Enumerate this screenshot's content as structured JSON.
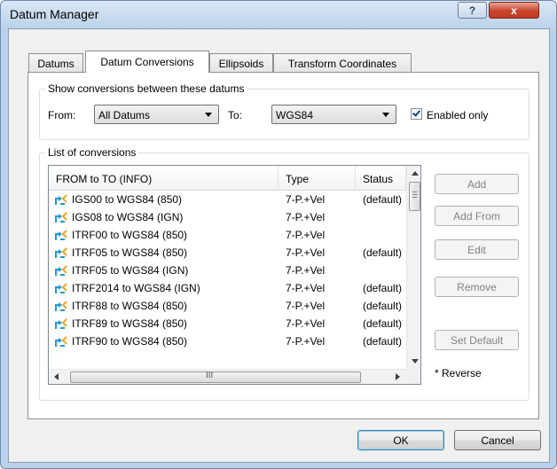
{
  "window": {
    "title": "Datum Manager",
    "help_label": "?",
    "close_label": "x"
  },
  "tabs": [
    {
      "label": "Datums"
    },
    {
      "label": "Datum Conversions"
    },
    {
      "label": "Ellipsoids"
    },
    {
      "label": "Transform Coordinates"
    }
  ],
  "filter": {
    "group_label": "Show conversions between these datums",
    "from_label": "From:",
    "from_value": "All Datums",
    "to_label": "To:",
    "to_value": "WGS84",
    "enabled_only_label": "Enabled only",
    "enabled_only_checked": true
  },
  "list": {
    "group_label": "List of conversions",
    "columns": [
      "FROM to TO (INFO)",
      "Type",
      "Status"
    ],
    "rows": [
      {
        "name": "IGS00 to WGS84 (850)",
        "type": "7-P.+Vel",
        "status": "(default)"
      },
      {
        "name": "IGS08 to WGS84 (IGN)",
        "type": "7-P.+Vel",
        "status": ""
      },
      {
        "name": "ITRF00 to WGS84 (850)",
        "type": "7-P.+Vel",
        "status": ""
      },
      {
        "name": "ITRF05 to WGS84 (850)",
        "type": "7-P.+Vel",
        "status": "(default)"
      },
      {
        "name": "ITRF05 to WGS84 (IGN)",
        "type": "7-P.+Vel",
        "status": ""
      },
      {
        "name": "ITRF2014 to WGS84 (IGN)",
        "type": "7-P.+Vel",
        "status": "(default)"
      },
      {
        "name": "ITRF88 to WGS84 (850)",
        "type": "7-P.+Vel",
        "status": "(default)"
      },
      {
        "name": "ITRF89 to WGS84 (850)",
        "type": "7-P.+Vel",
        "status": "(default)"
      },
      {
        "name": "ITRF90 to WGS84 (850)",
        "type": "7-P.+Vel",
        "status": "(default)"
      }
    ],
    "hscroll_grip": "III"
  },
  "buttons": {
    "add": "Add",
    "add_from": "Add From",
    "edit": "Edit",
    "remove": "Remove",
    "set_default": "Set Default",
    "reverse_note": "* Reverse",
    "ok": "OK",
    "cancel": "Cancel"
  },
  "colors": {
    "icon_primary": "#1e9ad6",
    "icon_secondary": "#f2a41f"
  },
  "icons": {
    "row_icon": "conversion-arrows-icon"
  }
}
